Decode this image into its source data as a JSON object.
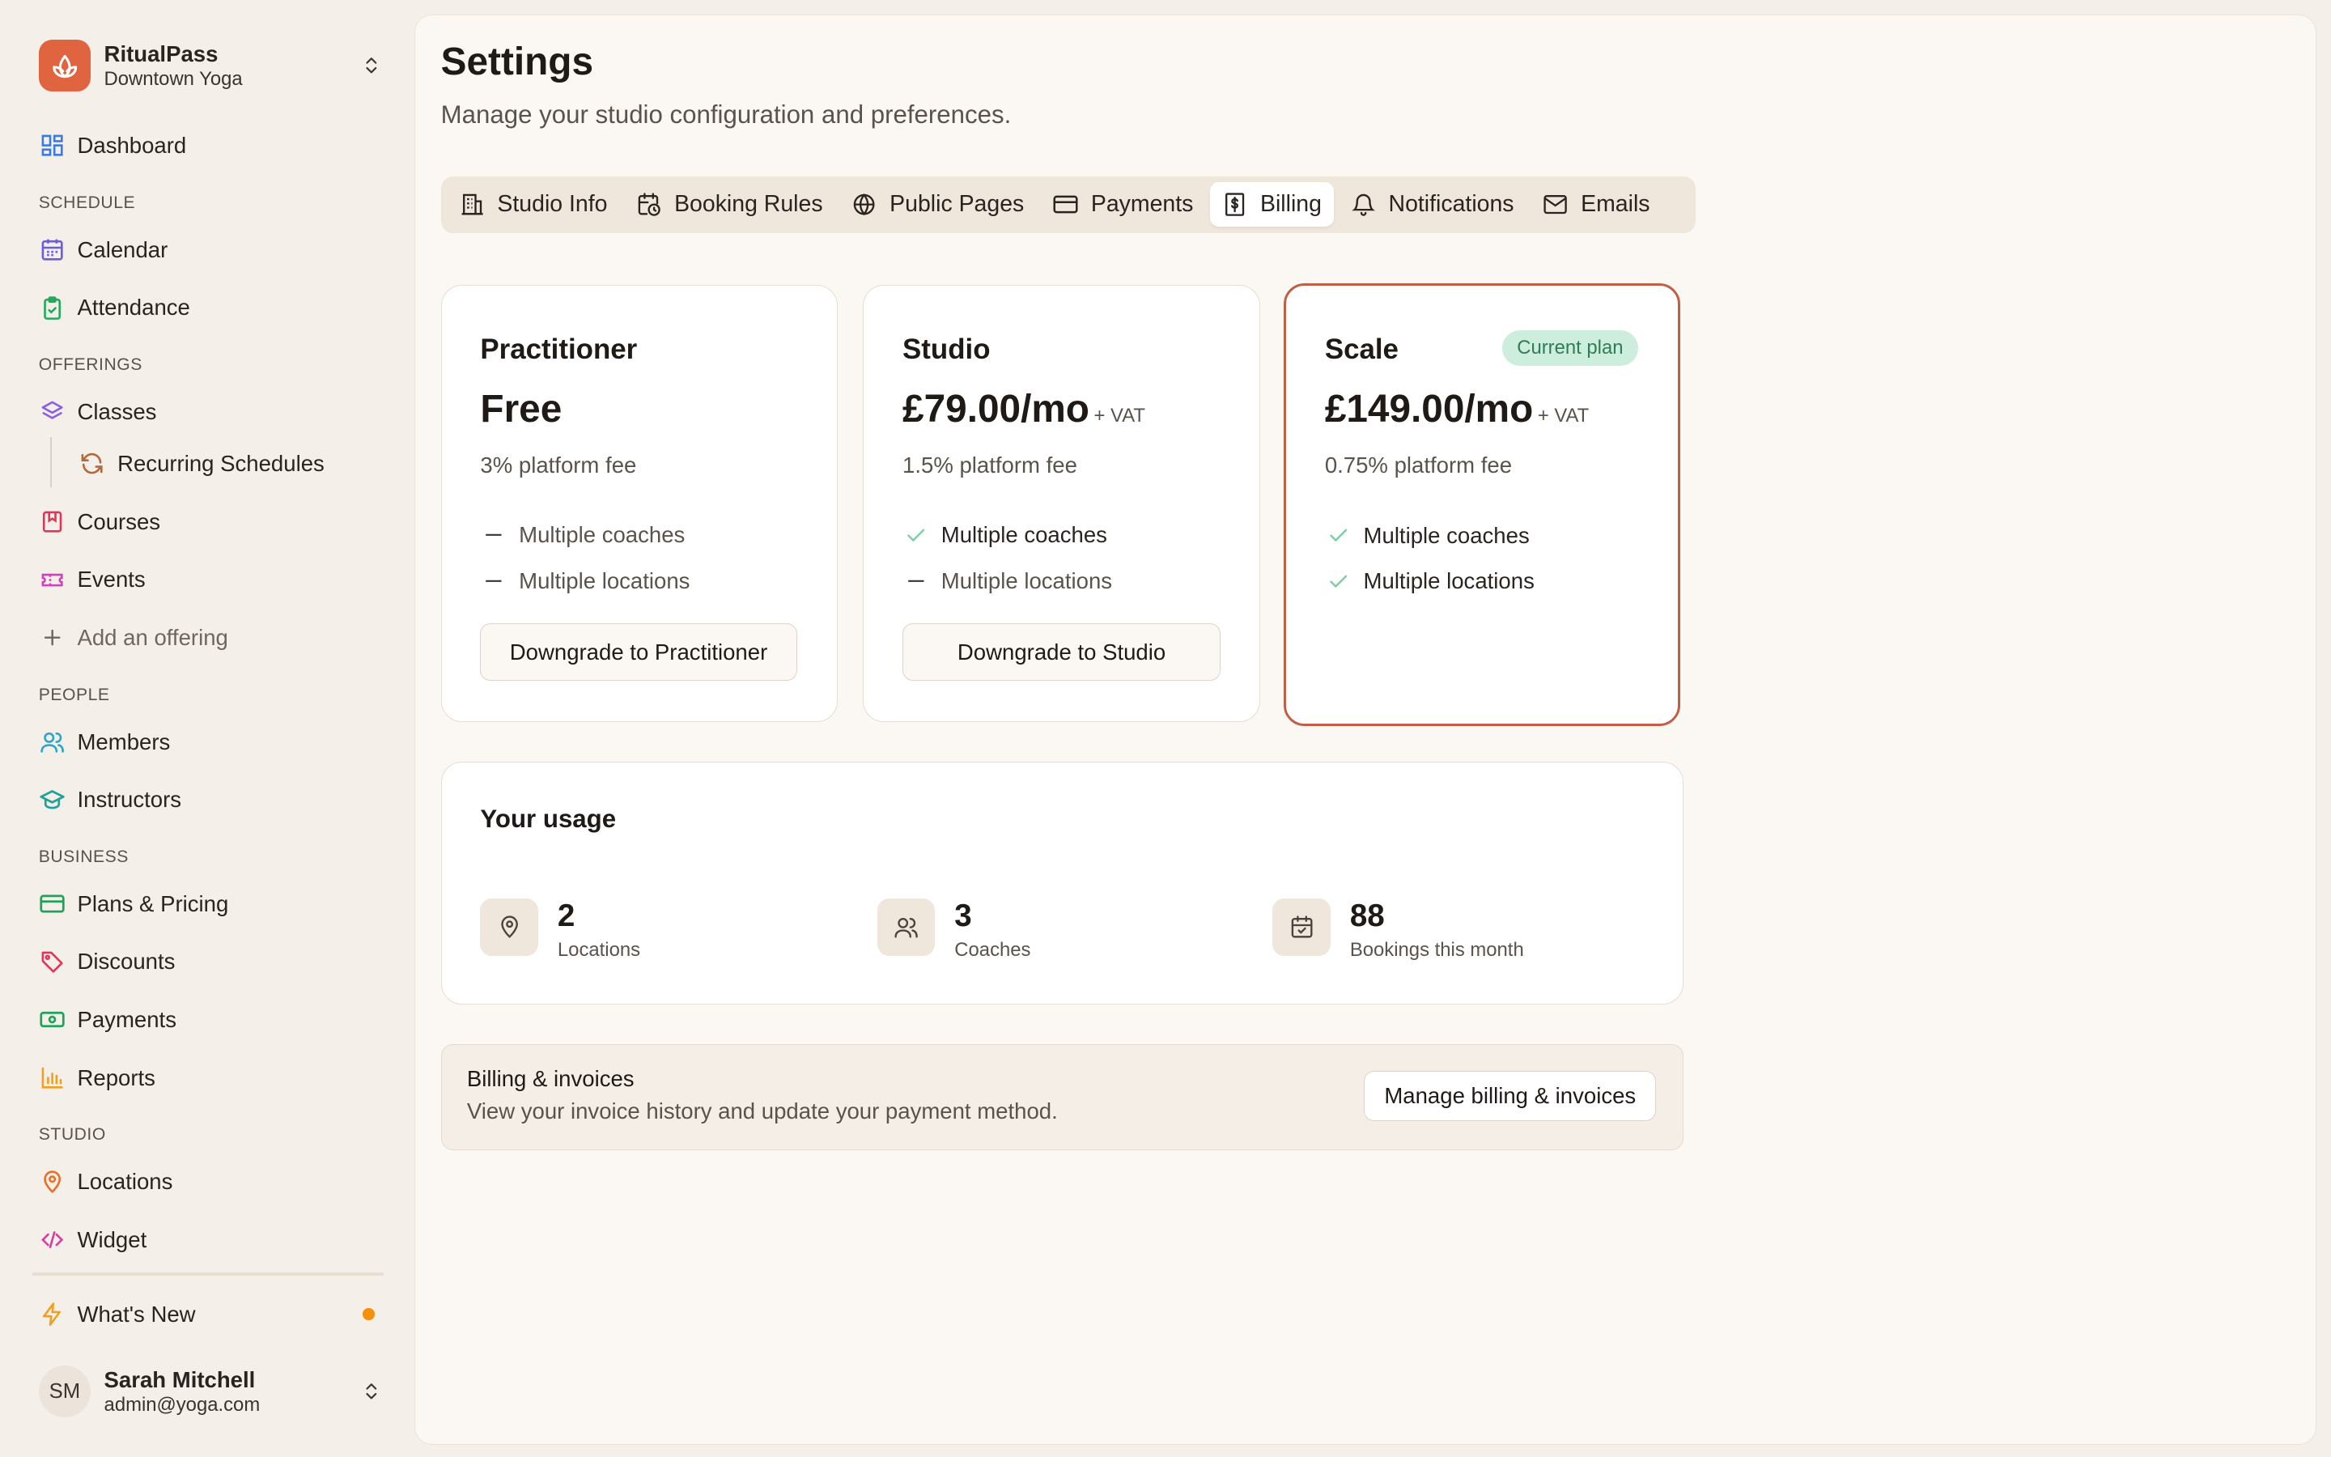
{
  "brand": {
    "name": "RitualPass",
    "location": "Downtown Yoga"
  },
  "sidebar": {
    "dashboard": "Dashboard",
    "sections": {
      "schedule": "SCHEDULE",
      "offerings": "OFFERINGS",
      "people": "PEOPLE",
      "business": "BUSINESS",
      "studio": "STUDIO"
    },
    "items": {
      "calendar": "Calendar",
      "attendance": "Attendance",
      "classes": "Classes",
      "recurring": "Recurring Schedules",
      "courses": "Courses",
      "events": "Events",
      "add_offering": "Add an offering",
      "members": "Members",
      "instructors": "Instructors",
      "plans": "Plans & Pricing",
      "discounts": "Discounts",
      "payments": "Payments",
      "reports": "Reports",
      "locations": "Locations",
      "widget": "Widget"
    },
    "whats_new": "What's New"
  },
  "user": {
    "initials": "SM",
    "name": "Sarah Mitchell",
    "email": "admin@yoga.com"
  },
  "header": {
    "title": "Settings",
    "subtitle": "Manage your studio configuration and preferences."
  },
  "tabs": [
    {
      "label": "Studio Info",
      "icon": "building-icon"
    },
    {
      "label": "Booking Rules",
      "icon": "calendar-clock-icon"
    },
    {
      "label": "Public Pages",
      "icon": "globe-icon"
    },
    {
      "label": "Payments",
      "icon": "credit-card-icon"
    },
    {
      "label": "Billing",
      "icon": "receipt-icon",
      "active": true
    },
    {
      "label": "Notifications",
      "icon": "bell-icon"
    },
    {
      "label": "Emails",
      "icon": "mail-icon"
    }
  ],
  "plans": [
    {
      "name": "Practitioner",
      "price": "Free",
      "vat": "",
      "fee": "3% platform fee",
      "features": [
        {
          "label": "Multiple coaches",
          "included": false
        },
        {
          "label": "Multiple locations",
          "included": false
        }
      ],
      "button": "Downgrade to Practitioner"
    },
    {
      "name": "Studio",
      "price": "£79.00/mo",
      "vat": "+ VAT",
      "fee": "1.5% platform fee",
      "features": [
        {
          "label": "Multiple coaches",
          "included": true
        },
        {
          "label": "Multiple locations",
          "included": false
        }
      ],
      "button": "Downgrade to Studio"
    },
    {
      "name": "Scale",
      "price": "£149.00/mo",
      "vat": "+ VAT",
      "fee": "0.75% platform fee",
      "badge": "Current plan",
      "features": [
        {
          "label": "Multiple coaches",
          "included": true
        },
        {
          "label": "Multiple locations",
          "included": true
        }
      ]
    }
  ],
  "usage": {
    "title": "Your usage",
    "stats": [
      {
        "value": "2",
        "label": "Locations",
        "icon": "map-pin-icon"
      },
      {
        "value": "3",
        "label": "Coaches",
        "icon": "users-icon"
      },
      {
        "value": "88",
        "label": "Bookings this month",
        "icon": "calendar-check-icon"
      }
    ]
  },
  "billing": {
    "title": "Billing & invoices",
    "subtitle": "View your invoice history and update your payment method.",
    "button": "Manage billing & invoices"
  },
  "colors": {
    "accent": "#e0643f",
    "current_plan_border": "#c05f45",
    "badge_bg": "#cdeedd",
    "badge_text": "#2f7d55",
    "check": "#7fcfa6",
    "new_dot": "#f5900a"
  }
}
